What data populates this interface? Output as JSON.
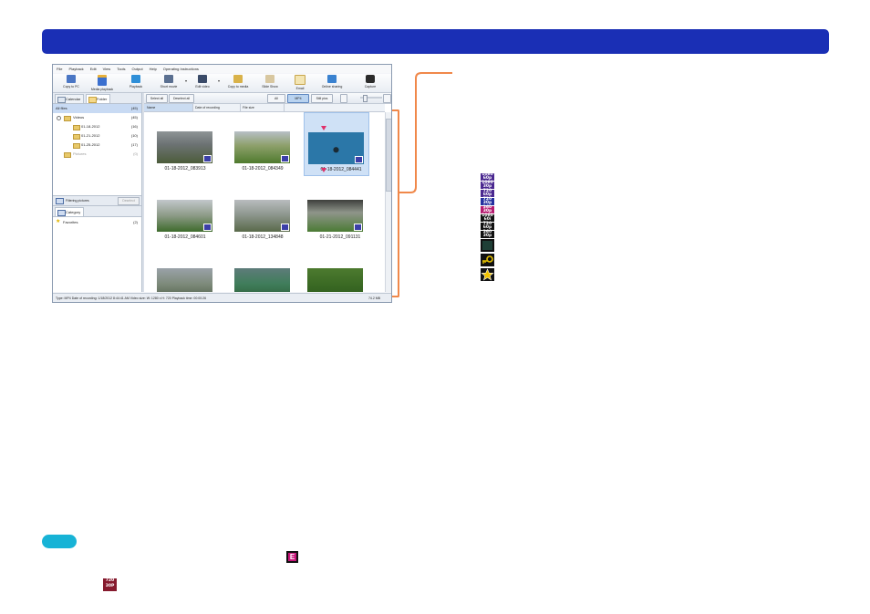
{
  "menu": [
    "File",
    "Playback",
    "Edit",
    "View",
    "Tools",
    "Output",
    "Help",
    "Operating Instructions"
  ],
  "toolbar": [
    {
      "label": "Copy to PC",
      "icon": "copy-to-pc-icon"
    },
    {
      "label": "Media playback",
      "icon": "media-playback-icon"
    },
    {
      "label": "Playback",
      "icon": "playback-icon"
    },
    {
      "label": "Short movie",
      "icon": "short-movie-icon"
    },
    {
      "label": "Edit video",
      "icon": "edit-video-icon"
    },
    {
      "label": "Copy to media",
      "icon": "copy-to-media-icon"
    },
    {
      "label": "Slide Show",
      "icon": "slide-show-icon"
    },
    {
      "label": "Email",
      "icon": "email-icon"
    },
    {
      "label": "Online sharing",
      "icon": "online-sharing-icon"
    },
    {
      "label": "Capture",
      "icon": "capture-icon"
    }
  ],
  "left_tabs": {
    "calendar": "Calendar",
    "folder": "Folder"
  },
  "tree": [
    {
      "label": "All files",
      "count": "(45)"
    },
    {
      "label": "Videos",
      "count": "(45)"
    },
    {
      "label": "01-18-2012",
      "count": "(16)"
    },
    {
      "label": "01-21-2012",
      "count": "(10)"
    },
    {
      "label": "01-25-2012",
      "count": "(17)"
    },
    {
      "label": "Pictures",
      "count": "(0)"
    }
  ],
  "filter": {
    "label": "Filtering pictures",
    "button": "Deselect"
  },
  "category_tab": "Category",
  "favorites": {
    "label": "Favorites",
    "count": "(2)"
  },
  "right_toolbar": {
    "select_all": "Select all",
    "deselect_all": "Deselect all",
    "all": "All",
    "mp4": "MP4",
    "stills": "Still pics"
  },
  "columns": [
    "Name",
    "Date of recording",
    "File size"
  ],
  "thumbnails": [
    {
      "caption": "01-18-2012_083913",
      "selected": false
    },
    {
      "caption": "01-18-2012_084349",
      "selected": false
    },
    {
      "caption": "01-18-2012_084441",
      "selected": true
    },
    {
      "caption": "01-18-2012_084601",
      "selected": false
    },
    {
      "caption": "01-18-2012_134848",
      "selected": false
    },
    {
      "caption": "01-21-2012_091131",
      "selected": false
    },
    {
      "caption": "",
      "selected": false
    },
    {
      "caption": "",
      "selected": false
    },
    {
      "caption": "",
      "selected": false
    }
  ],
  "status": {
    "left": "Type: MP4   Date of recording: 1/18/2012 8:44:41 AM   Video size: W: 1280 x H: 720 Playback time: 00:00:26",
    "right": "74.2 MB"
  },
  "legend_badges": [
    {
      "l1": "1080",
      "l2": "60p",
      "color": "pur"
    },
    {
      "l1": "1080",
      "l2": "30p",
      "color": "pur"
    },
    {
      "l1": "720",
      "l2": "60p",
      "color": "pur"
    },
    {
      "l1": "720",
      "l2": "30p",
      "color": "blu"
    },
    {
      "l1": "360",
      "l2": "30p",
      "color": "mag"
    },
    {
      "l1": "1080",
      "l2": "60i",
      "color": "blk"
    },
    {
      "l1": "720",
      "l2": "60p",
      "color": "blk"
    },
    {
      "l1": "360",
      "l2": "30p",
      "color": "blk"
    }
  ],
  "legend_icons": [
    "thumbnail-icon",
    "key-icon",
    "favorite-star-icon"
  ],
  "note_badge": {
    "l1": "720",
    "l2": "30P"
  },
  "note_e": "E",
  "colors": {
    "banner": "#1a2fb5",
    "accent": "#f0884a",
    "note": "#17b3d6"
  }
}
